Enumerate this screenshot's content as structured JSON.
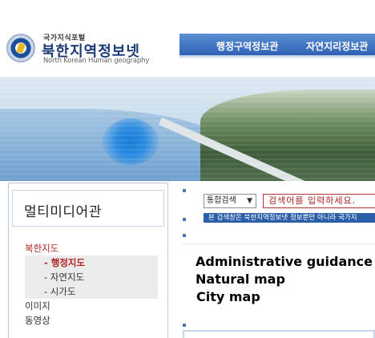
{
  "header": {
    "logo_small": "국가지식포털",
    "logo_title": "북한지역정보넷",
    "logo_english": "North Korean Human geography"
  },
  "topnav": {
    "items": [
      {
        "label": "행정구역정보관"
      },
      {
        "label": "자연지리정보관"
      }
    ]
  },
  "sidebar": {
    "title": "멀티미디어관",
    "menu": {
      "parent": "북한지도",
      "sub": [
        "- 행정지도",
        "- 자연지도",
        "- 시가도"
      ],
      "others": [
        "이미지",
        "동영상"
      ]
    }
  },
  "search": {
    "select_value": "통합검색",
    "placeholder": "검색어를 입력하세요."
  },
  "notice": "본 검색창은 북한지역정보넷 정보뿐만 아니라 국가지",
  "guide": {
    "lines": [
      "Administrative guidance",
      "Natural map",
      "City map"
    ]
  },
  "colors": {
    "accent_red": "#b22222",
    "nav_blue": "#2f62b4"
  }
}
